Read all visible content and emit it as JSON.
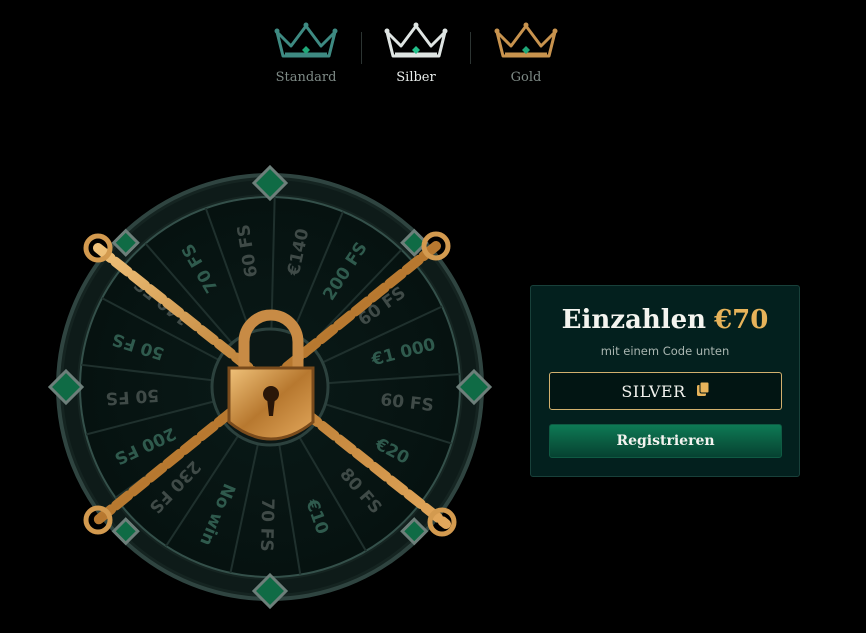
{
  "tiers": [
    {
      "label": "Standard",
      "icon": "crown-icon",
      "color": "#3e8a82"
    },
    {
      "label": "Silber",
      "icon": "crown-icon",
      "color": "#dfe5e3"
    },
    {
      "label": "Gold",
      "icon": "crown-icon",
      "color": "#c8934e"
    }
  ],
  "wheel": {
    "segments": [
      "€140",
      "200 FS",
      "60 FS",
      "€1 000",
      "60 FS",
      "€20",
      "80 FS",
      "€10",
      "70 FS",
      "No win",
      "230 FS",
      "200 FS",
      "50 FS",
      "50 FS",
      "140 FS",
      "70 FS",
      "60 FS"
    ],
    "status": "locked"
  },
  "offer": {
    "title": "Einzahlen",
    "amount": "€70",
    "subtitle": "mit einem Code unten",
    "code": "SILVER",
    "register_label": "Registrieren"
  },
  "colors": {
    "accent_gold": "#e7b35a",
    "card_bg": "#03201e",
    "button_green": "#0d7a55"
  }
}
